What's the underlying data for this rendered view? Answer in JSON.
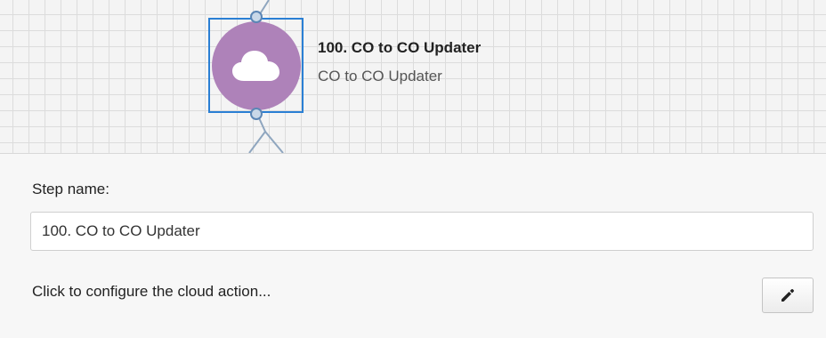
{
  "node": {
    "title": "100. CO to CO Updater",
    "subtitle": "CO to CO Updater",
    "icon": "cloud-icon",
    "color": "#ae82b9",
    "selection_color": "#2a7fd4"
  },
  "properties": {
    "step_name_label": "Step name:",
    "step_name_value": "100. CO to CO Updater",
    "configure_text": "Click to configure the cloud action...",
    "edit_icon": "pencil-icon"
  }
}
